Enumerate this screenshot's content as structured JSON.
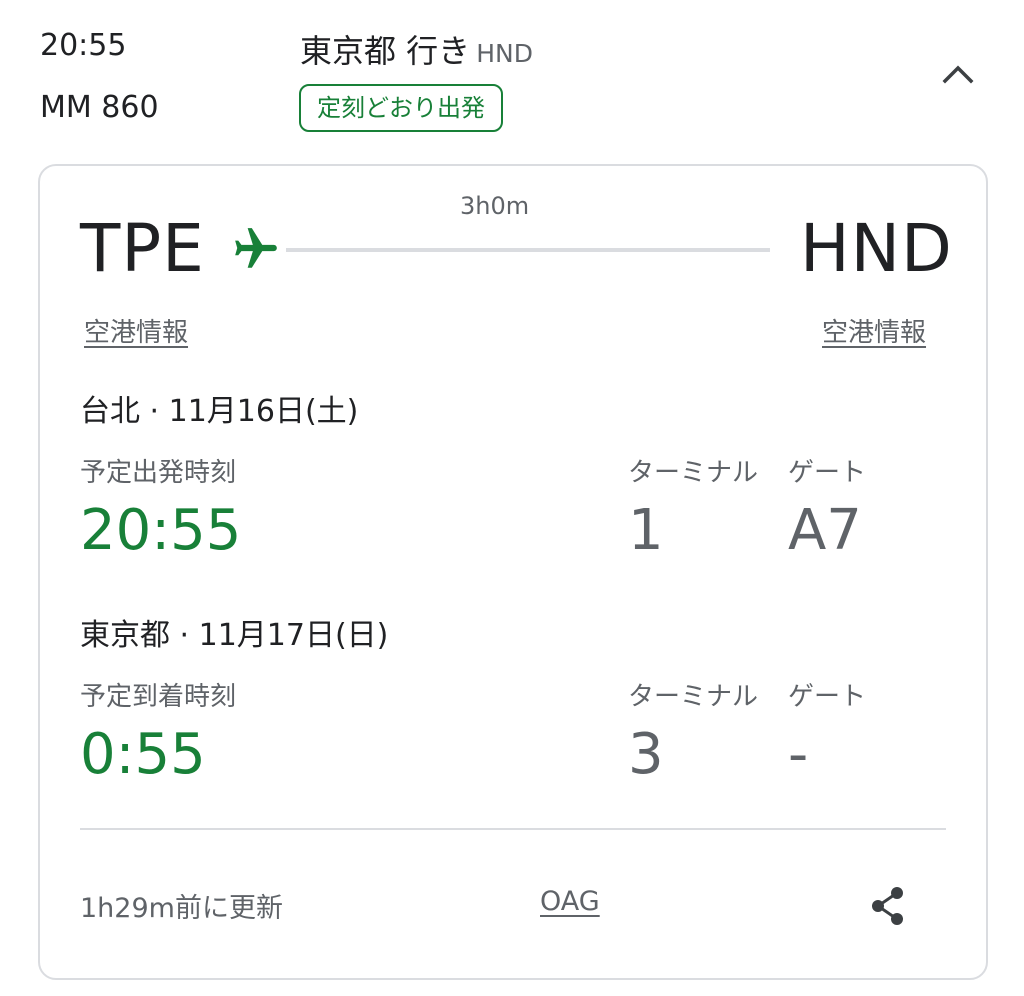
{
  "header": {
    "departure_time": "20:55",
    "flight_number": "MM 860",
    "destination_label": "東京都 行き",
    "destination_code": "HND",
    "status_badge": "定刻どおり出発"
  },
  "route": {
    "duration": "3h0m",
    "origin_code": "TPE",
    "destination_code": "HND",
    "origin_airport_link": "空港情報",
    "destination_airport_link": "空港情報"
  },
  "departure": {
    "city_date": "台北 · 11月16日(土)",
    "time_label": "予定出発時刻",
    "time": "20:55",
    "terminal_label": "ターミナル",
    "terminal": "1",
    "gate_label": "ゲート",
    "gate": "A7"
  },
  "arrival": {
    "city_date": "東京都 · 11月17日(日)",
    "time_label": "予定到着時刻",
    "time": "0:55",
    "terminal_label": "ターミナル",
    "terminal": "3",
    "gate_label": "ゲート",
    "gate": "-"
  },
  "footer": {
    "updated": "1h29m前に更新",
    "source": "OAG"
  },
  "icons": {
    "collapse": "chevron-up-icon",
    "plane": "airplane-icon",
    "share": "share-icon"
  },
  "colors": {
    "accent_green": "#188038",
    "text_primary": "#202124",
    "text_secondary": "#5f6368",
    "border": "#dadce0"
  }
}
